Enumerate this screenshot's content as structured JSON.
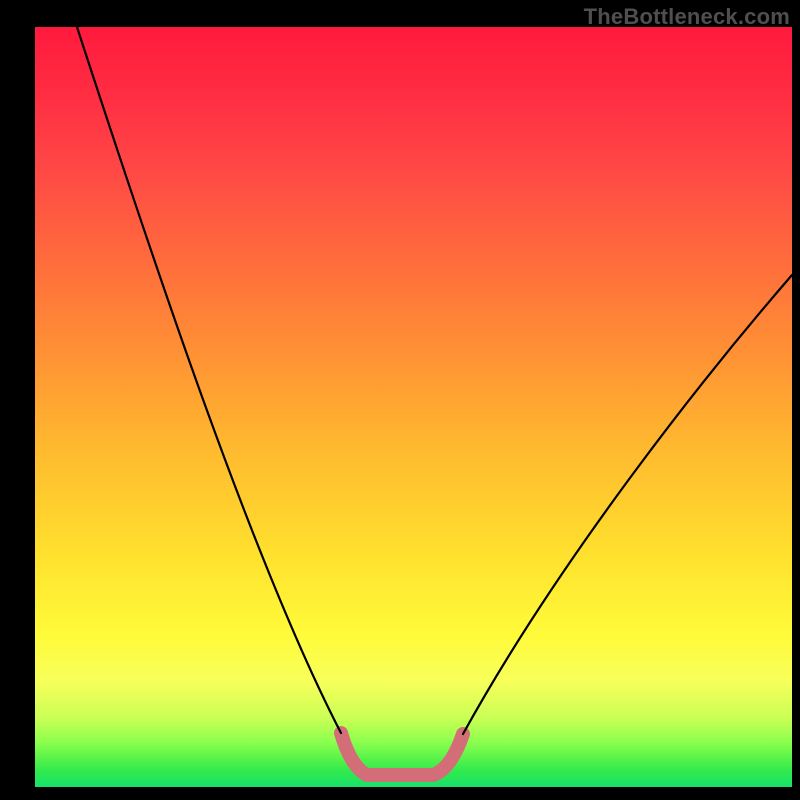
{
  "watermark": "TheBottleneck.com",
  "colors": {
    "black": "#000000",
    "pink_highlight": "#d36d78"
  },
  "chart_data": {
    "type": "line",
    "title": "",
    "xlabel": "",
    "ylabel": "",
    "xlim": [
      0,
      100
    ],
    "ylim": [
      0,
      100
    ],
    "grid": false,
    "legend": false,
    "series": [
      {
        "name": "bottleneck-curve",
        "x": [
          5,
          10,
          15,
          20,
          25,
          30,
          35,
          38,
          41,
          44,
          47,
          50,
          53,
          55,
          60,
          65,
          70,
          75,
          80,
          85,
          90,
          95,
          100
        ],
        "y": [
          100,
          88,
          76,
          64,
          52,
          40,
          28,
          18,
          10,
          4,
          1,
          0,
          0,
          1,
          6,
          14,
          23,
          32,
          41,
          49,
          56,
          62,
          67
        ]
      }
    ],
    "annotations": [
      {
        "name": "flat-bottom-highlight",
        "x_range": [
          42,
          56
        ],
        "y_approx": 0,
        "color": "#d36d78"
      }
    ]
  }
}
